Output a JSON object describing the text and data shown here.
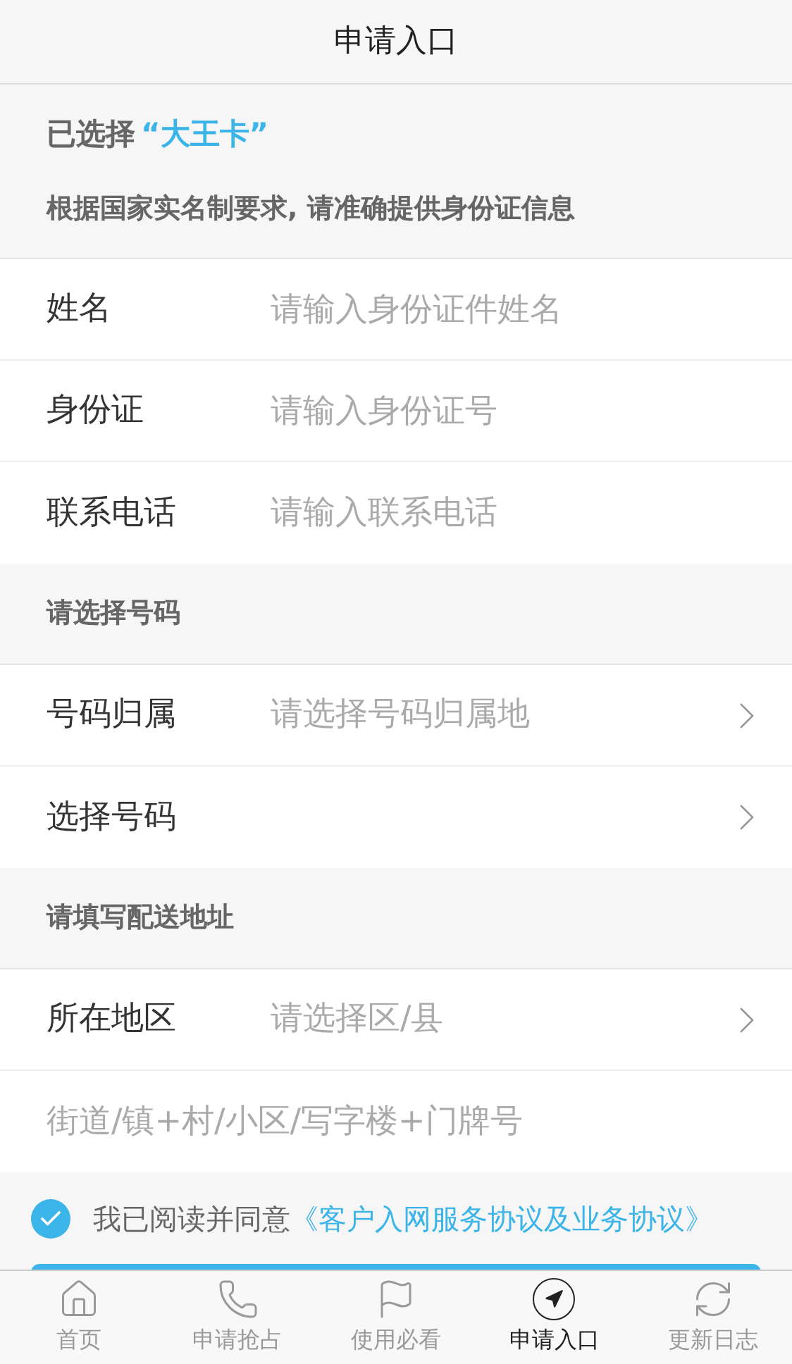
{
  "header": {
    "title": "申请入口"
  },
  "intro": {
    "selected_prefix": "已选择",
    "selected_card": "“大王卡”",
    "notice": "根据国家实名制要求, 请准确提供身份证信息"
  },
  "sections": [
    {
      "fields": [
        {
          "kind": "input",
          "label": "姓名",
          "placeholder": "请输入身份证件姓名"
        },
        {
          "kind": "input",
          "label": "身份证",
          "placeholder": "请输入身份证号"
        },
        {
          "kind": "input",
          "label": "联系电话",
          "placeholder": "请输入联系电话"
        }
      ]
    },
    {
      "title": "请选择号码",
      "fields": [
        {
          "kind": "select",
          "label": "号码归属",
          "placeholder": "请选择号码归属地"
        },
        {
          "kind": "select",
          "label": "选择号码"
        }
      ]
    },
    {
      "title": "请填写配送地址",
      "fields": [
        {
          "kind": "select",
          "label": "所在地区",
          "placeholder": "请选择区/县"
        },
        {
          "kind": "input",
          "placeholder": "街道/镇+村/小区/写字楼+门牌号"
        }
      ]
    }
  ],
  "agreement": {
    "checked": true,
    "text": "我已阅读并同意",
    "link": "《客户入网服务协议及业务协议》"
  },
  "tabs": [
    {
      "kind": "home",
      "label": "首页",
      "selected": false
    },
    {
      "kind": "phone",
      "label": "申请抢占",
      "selected": false
    },
    {
      "kind": "flag",
      "label": "使用必看",
      "selected": false
    },
    {
      "kind": "navigate",
      "label": "申请入口",
      "selected": true
    },
    {
      "kind": "refresh",
      "label": "更新日志",
      "selected": false
    }
  ]
}
